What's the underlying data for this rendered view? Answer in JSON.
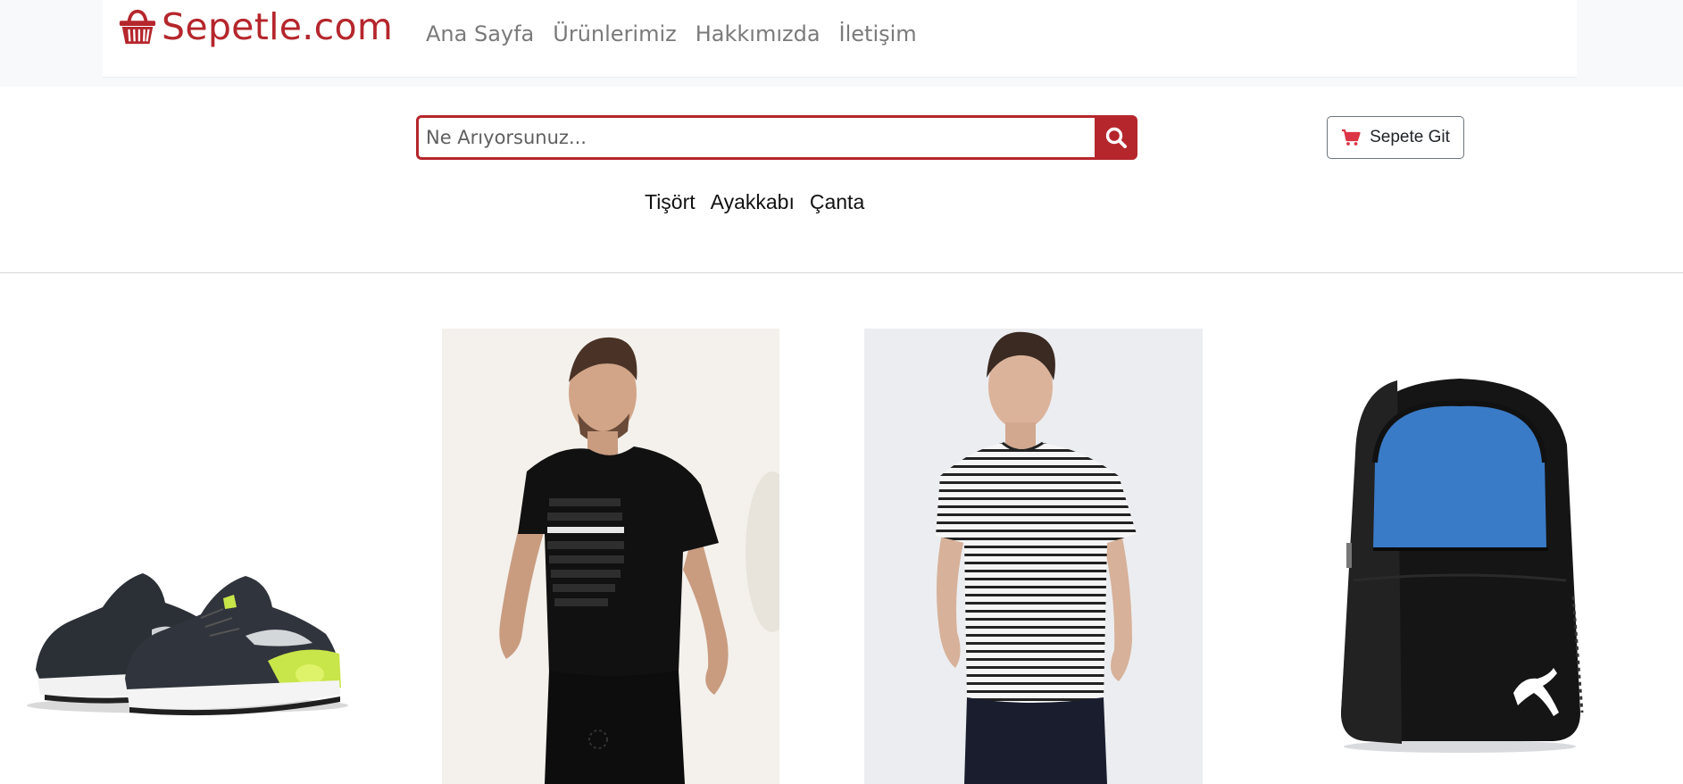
{
  "brand": {
    "name": "Sepetle.com",
    "icon": "basket-icon",
    "color": "#b5262c"
  },
  "nav": {
    "links": [
      {
        "label": "Ana Sayfa"
      },
      {
        "label": "Ürünlerimiz"
      },
      {
        "label": "Hakkımızda"
      },
      {
        "label": "İletişim"
      }
    ]
  },
  "search": {
    "placeholder": "Ne Arıyorsunuz...",
    "value": "",
    "button_icon": "search-icon"
  },
  "cart": {
    "label": "Sepete Git",
    "icon": "cart-icon",
    "icon_color": "#dc3545"
  },
  "categories": [
    {
      "label": "Tişört"
    },
    {
      "label": "Ayakkabı"
    },
    {
      "label": "Çanta"
    }
  ],
  "products": [
    {
      "kind": "sneaker",
      "icon": "sneaker-image"
    },
    {
      "kind": "black-tshirt",
      "icon": "black-tshirt-image"
    },
    {
      "kind": "striped-tshirt",
      "icon": "striped-tshirt-image"
    },
    {
      "kind": "backpack",
      "icon": "backpack-image"
    }
  ],
  "colors": {
    "accent": "#b5262c",
    "nav_text": "#7a7a7a",
    "band": "#f8f9fa"
  }
}
